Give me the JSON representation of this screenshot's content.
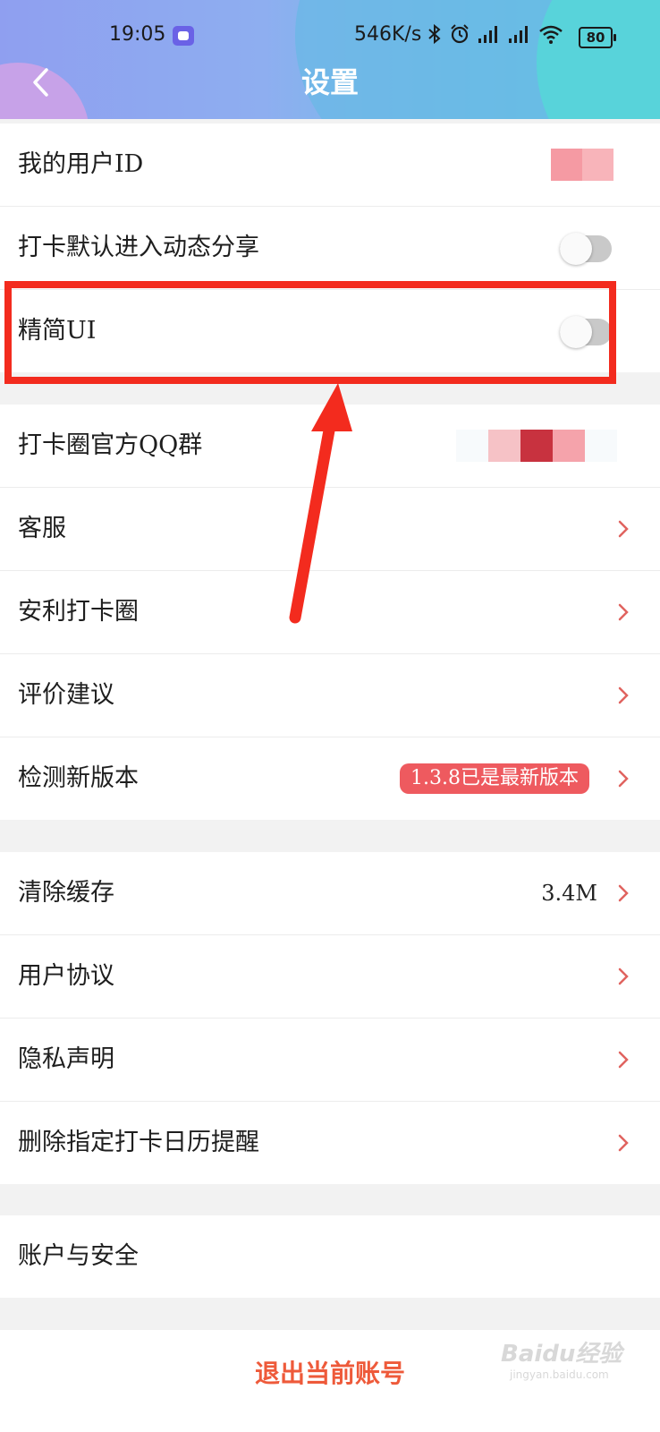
{
  "status_bar": {
    "time": "19:05",
    "net_speed": "546K/s",
    "battery": "80",
    "icons": [
      "app-icon",
      "bluetooth-icon",
      "alarm-icon",
      "signal-icon",
      "signal-icon",
      "wifi-icon",
      "battery-icon"
    ]
  },
  "header": {
    "title": "设置",
    "back_icon": "chevron-left-icon"
  },
  "section1": [
    {
      "label": "我的用户ID"
    },
    {
      "label": "打卡默认进入动态分享",
      "toggle": false
    },
    {
      "label": "精简UI",
      "toggle": false
    }
  ],
  "section2": [
    {
      "label": "打卡圈官方QQ群"
    },
    {
      "label": "客服"
    },
    {
      "label": "安利打卡圈"
    },
    {
      "label": "评价建议"
    },
    {
      "label": "检测新版本",
      "badge": "1.3.8已是最新版本"
    }
  ],
  "section3": [
    {
      "label": "清除缓存",
      "value": "3.4M"
    },
    {
      "label": "用户协议"
    },
    {
      "label": "隐私声明"
    },
    {
      "label": "删除指定打卡日历提醒"
    }
  ],
  "section4": [
    {
      "label": "账户与安全"
    }
  ],
  "logout": {
    "label": "退出当前账号"
  },
  "watermark": {
    "main": "Baidu经验",
    "sub": "jingyan.baidu.com"
  },
  "colors": {
    "accent": "#ee5a3a",
    "badge": "#ee5a5f",
    "highlight": "#f32b1e",
    "chevron": "#e0635f"
  }
}
